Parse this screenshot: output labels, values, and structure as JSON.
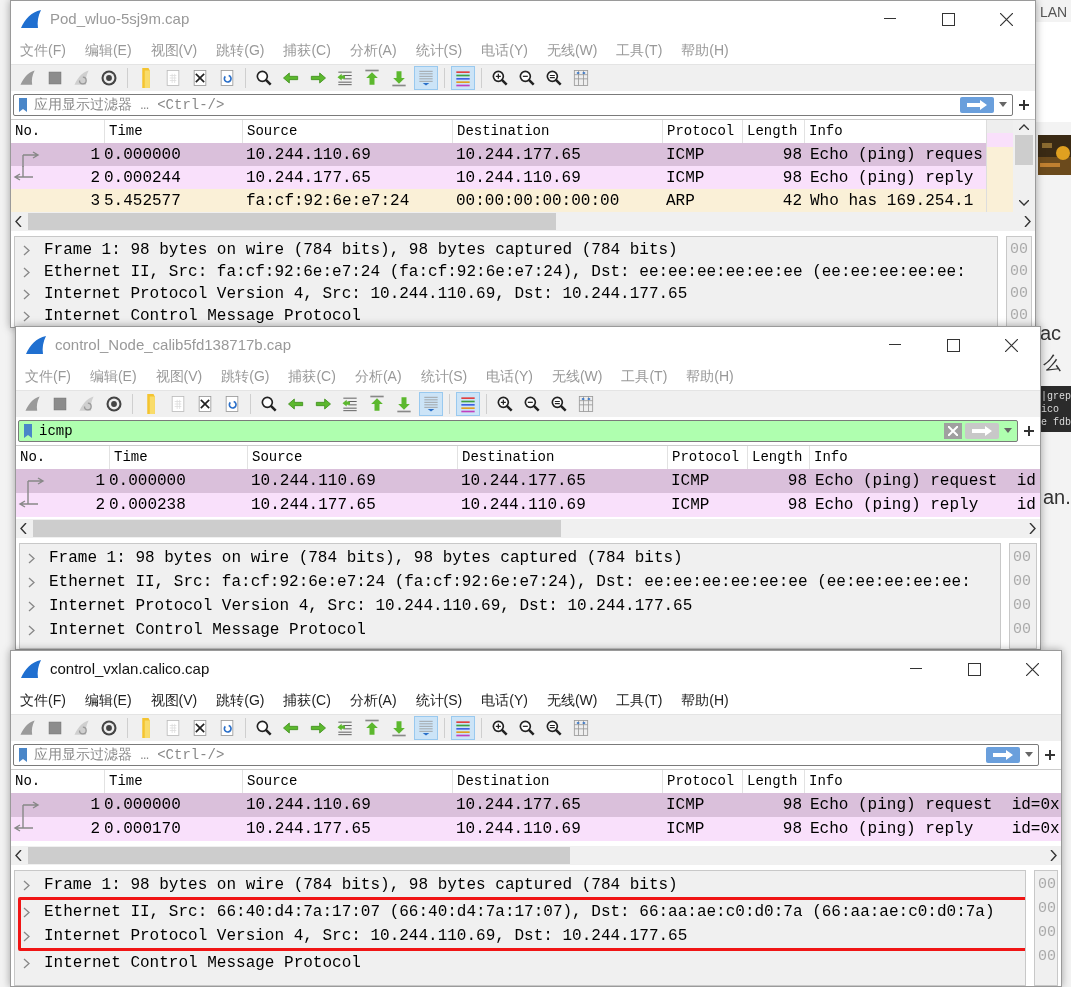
{
  "background": {
    "fragments": [
      "LAN",
      "ac",
      "么",
      "an."
    ],
    "code_lines": [
      "|grep",
      "ico",
      "e fdb"
    ]
  },
  "windows": [
    {
      "title": "Pod_wluo-5sj9m.cap",
      "active": false,
      "minimap": true,
      "menu": [
        "文件(F)",
        "编辑(E)",
        "视图(V)",
        "跳转(G)",
        "捕获(C)",
        "分析(A)",
        "统计(S)",
        "电话(Y)",
        "无线(W)",
        "工具(T)",
        "帮助(H)"
      ],
      "toolbar": [
        {
          "kind": "fin",
          "pressed": false
        },
        {
          "kind": "stop",
          "pressed": false
        },
        {
          "kind": "restart",
          "pressed": false
        },
        {
          "kind": "gear",
          "pressed": false
        },
        {
          "kind": "sep"
        },
        {
          "kind": "folder",
          "pressed": false
        },
        {
          "kind": "doc",
          "pressed": false
        },
        {
          "kind": "closefile",
          "pressed": false
        },
        {
          "kind": "reload",
          "pressed": false
        },
        {
          "kind": "sep"
        },
        {
          "kind": "search",
          "pressed": false
        },
        {
          "kind": "back",
          "pressed": false
        },
        {
          "kind": "forward",
          "pressed": false
        },
        {
          "kind": "goto",
          "pressed": false
        },
        {
          "kind": "first",
          "pressed": false
        },
        {
          "kind": "last",
          "pressed": false
        },
        {
          "kind": "autoscroll",
          "pressed": true
        },
        {
          "kind": "sep"
        },
        {
          "kind": "colorize",
          "pressed": true
        },
        {
          "kind": "sep"
        },
        {
          "kind": "zoomin",
          "pressed": false
        },
        {
          "kind": "zoomout",
          "pressed": false
        },
        {
          "kind": "zoomreset",
          "pressed": false
        },
        {
          "kind": "resize",
          "pressed": false
        }
      ],
      "filter": {
        "placeholder": "应用显示过滤器 … <Ctrl-/>",
        "valid": false
      },
      "columns": [
        "No.",
        "Time",
        "Source",
        "Destination",
        "Protocol",
        "Length",
        "Info"
      ],
      "rows": [
        {
          "no": "1",
          "time": "0.000000",
          "source": "10.244.110.69",
          "destination": "10.244.177.65",
          "protocol": "ICMP",
          "length": "98",
          "info": "Echo (ping) reques",
          "kind": "request",
          "color": "#dac0db"
        },
        {
          "no": "2",
          "time": "0.000244",
          "source": "10.244.177.65",
          "destination": "10.244.110.69",
          "protocol": "ICMP",
          "length": "98",
          "info": "Echo (ping) reply",
          "kind": "reply",
          "color": "#f9e0fb"
        },
        {
          "no": "3",
          "time": "5.452577",
          "source": "fa:cf:92:6e:e7:24",
          "destination": "00:00:00:00:00:00",
          "protocol": "ARP",
          "length": "42",
          "info": "Who has 169.254.1",
          "kind": "plain",
          "color": "#faf0d7"
        }
      ],
      "details": [
        {
          "text": "Frame 1: 98 bytes on wire (784 bits), 98 bytes captured (784 bits)",
          "expanded": false,
          "highlighted": false
        },
        {
          "text": "Ethernet II, Src: fa:cf:92:6e:e7:24 (fa:cf:92:6e:e7:24), Dst: ee:ee:ee:ee:ee:ee (ee:ee:ee:ee:ee:",
          "expanded": false,
          "highlighted": false
        },
        {
          "text": "Internet Protocol Version 4, Src: 10.244.110.69, Dst: 10.244.177.65",
          "expanded": false,
          "highlighted": false
        },
        {
          "text": "Internet Control Message Protocol",
          "expanded": false,
          "highlighted": false
        }
      ],
      "hex": [
        "00",
        "00",
        "00",
        "00"
      ]
    },
    {
      "title": "control_Node_calib5fd138717b.cap",
      "active": false,
      "minimap": false,
      "menu": [
        "文件(F)",
        "编辑(E)",
        "视图(V)",
        "跳转(G)",
        "捕获(C)",
        "分析(A)",
        "统计(S)",
        "电话(Y)",
        "无线(W)",
        "工具(T)",
        "帮助(H)"
      ],
      "toolbar": [
        {
          "kind": "fin",
          "pressed": false
        },
        {
          "kind": "stop",
          "pressed": false
        },
        {
          "kind": "restart",
          "pressed": false
        },
        {
          "kind": "gear",
          "pressed": false
        },
        {
          "kind": "sep"
        },
        {
          "kind": "folder",
          "pressed": false
        },
        {
          "kind": "doc",
          "pressed": false
        },
        {
          "kind": "closefile",
          "pressed": false
        },
        {
          "kind": "reload",
          "pressed": false
        },
        {
          "kind": "sep"
        },
        {
          "kind": "search",
          "pressed": false
        },
        {
          "kind": "back",
          "pressed": false
        },
        {
          "kind": "forward",
          "pressed": false
        },
        {
          "kind": "goto",
          "pressed": false
        },
        {
          "kind": "first",
          "pressed": false
        },
        {
          "kind": "last",
          "pressed": false
        },
        {
          "kind": "autoscroll",
          "pressed": true
        },
        {
          "kind": "sep"
        },
        {
          "kind": "colorize",
          "pressed": true
        },
        {
          "kind": "sep"
        },
        {
          "kind": "zoomin",
          "pressed": false
        },
        {
          "kind": "zoomout",
          "pressed": false
        },
        {
          "kind": "zoomreset",
          "pressed": false
        },
        {
          "kind": "resize",
          "pressed": false
        }
      ],
      "filter": {
        "value": "icmp",
        "valid": true
      },
      "columns": [
        "No.",
        "Time",
        "Source",
        "Destination",
        "Protocol",
        "Length",
        "Info"
      ],
      "rows": [
        {
          "no": "1",
          "time": "0.000000",
          "source": "10.244.110.69",
          "destination": "10.244.177.65",
          "protocol": "ICMP",
          "length": "98",
          "info": "Echo (ping) request  id",
          "kind": "request",
          "color": "#dac0db"
        },
        {
          "no": "2",
          "time": "0.000238",
          "source": "10.244.177.65",
          "destination": "10.244.110.69",
          "protocol": "ICMP",
          "length": "98",
          "info": "Echo (ping) reply    id",
          "kind": "reply",
          "color": "#f9e0fb"
        }
      ],
      "details": [
        {
          "text": "Frame 1: 98 bytes on wire (784 bits), 98 bytes captured (784 bits)",
          "expanded": false,
          "highlighted": false
        },
        {
          "text": "Ethernet II, Src: fa:cf:92:6e:e7:24 (fa:cf:92:6e:e7:24), Dst: ee:ee:ee:ee:ee:ee (ee:ee:ee:ee:ee:",
          "expanded": false,
          "highlighted": false
        },
        {
          "text": "Internet Protocol Version 4, Src: 10.244.110.69, Dst: 10.244.177.65",
          "expanded": false,
          "highlighted": false
        },
        {
          "text": "Internet Control Message Protocol",
          "expanded": false,
          "highlighted": false
        }
      ],
      "hex": [
        "00",
        "00",
        "00",
        "00"
      ]
    },
    {
      "title": "control_vxlan.calico.cap",
      "active": true,
      "minimap": false,
      "menu": [
        "文件(F)",
        "编辑(E)",
        "视图(V)",
        "跳转(G)",
        "捕获(C)",
        "分析(A)",
        "统计(S)",
        "电话(Y)",
        "无线(W)",
        "工具(T)",
        "帮助(H)"
      ],
      "toolbar": [
        {
          "kind": "fin",
          "pressed": false
        },
        {
          "kind": "stop",
          "pressed": false
        },
        {
          "kind": "restart",
          "pressed": false
        },
        {
          "kind": "gear",
          "pressed": false
        },
        {
          "kind": "sep"
        },
        {
          "kind": "folder",
          "pressed": false
        },
        {
          "kind": "doc",
          "pressed": false
        },
        {
          "kind": "closefile",
          "pressed": false
        },
        {
          "kind": "reload",
          "pressed": false
        },
        {
          "kind": "sep"
        },
        {
          "kind": "search",
          "pressed": false
        },
        {
          "kind": "back",
          "pressed": false
        },
        {
          "kind": "forward",
          "pressed": false
        },
        {
          "kind": "goto",
          "pressed": false
        },
        {
          "kind": "first",
          "pressed": false
        },
        {
          "kind": "last",
          "pressed": false
        },
        {
          "kind": "autoscroll",
          "pressed": true
        },
        {
          "kind": "sep"
        },
        {
          "kind": "colorize",
          "pressed": true
        },
        {
          "kind": "sep"
        },
        {
          "kind": "zoomin",
          "pressed": false
        },
        {
          "kind": "zoomout",
          "pressed": false
        },
        {
          "kind": "zoomreset",
          "pressed": false
        },
        {
          "kind": "resize",
          "pressed": false
        }
      ],
      "filter": {
        "placeholder": "应用显示过滤器 … <Ctrl-/>",
        "valid": false
      },
      "columns": [
        "No.",
        "Time",
        "Source",
        "Destination",
        "Protocol",
        "Length",
        "Info"
      ],
      "rows": [
        {
          "no": "1",
          "time": "0.000000",
          "source": "10.244.110.69",
          "destination": "10.244.177.65",
          "protocol": "ICMP",
          "length": "98",
          "info": "Echo (ping) request  id=0x",
          "kind": "request",
          "color": "#dac0db"
        },
        {
          "no": "2",
          "time": "0.000170",
          "source": "10.244.177.65",
          "destination": "10.244.110.69",
          "protocol": "ICMP",
          "length": "98",
          "info": "Echo (ping) reply    id=0x",
          "kind": "reply",
          "color": "#f9e0fb"
        }
      ],
      "details": [
        {
          "text": "Frame 1: 98 bytes on wire (784 bits), 98 bytes captured (784 bits)",
          "expanded": false,
          "highlighted": false
        },
        {
          "text": "Ethernet II, Src: 66:40:d4:7a:17:07 (66:40:d4:7a:17:07), Dst: 66:aa:ae:c0:d0:7a (66:aa:ae:c0:d0:7a)",
          "expanded": false,
          "highlighted": true
        },
        {
          "text": "Internet Protocol Version 4, Src: 10.244.110.69, Dst: 10.244.177.65",
          "expanded": false,
          "highlighted": true
        },
        {
          "text": "Internet Control Message Protocol",
          "expanded": false,
          "highlighted": false
        }
      ],
      "hex": [
        "00",
        "00",
        "00",
        "00"
      ]
    }
  ]
}
